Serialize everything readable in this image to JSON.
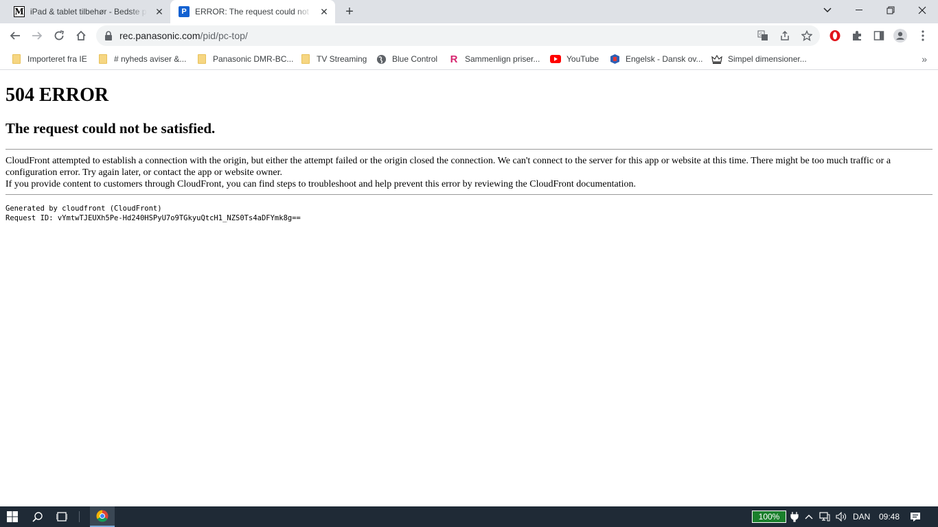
{
  "tabs": [
    {
      "title": "iPad & tablet tilbehør - Bedste priser",
      "favicon": "M",
      "active": false
    },
    {
      "title": "ERROR: The request could not be satisfied",
      "favicon": "P",
      "active": true
    }
  ],
  "toolbar": {
    "url_host": "rec.panasonic.com",
    "url_path": "/pid/pc-top/"
  },
  "bookmarks": [
    {
      "label": "Importeret fra IE",
      "icon": "folder-icon"
    },
    {
      "label": "# nyheds aviser &...",
      "icon": "folder-icon"
    },
    {
      "label": "Panasonic DMR-BC...",
      "icon": "folder-icon"
    },
    {
      "label": "TV Streaming",
      "icon": "folder-icon"
    },
    {
      "label": "Blue Control",
      "icon": "globe-icon"
    },
    {
      "label": "Sammenlign priser...",
      "icon": "pricerunner-icon"
    },
    {
      "label": "YouTube",
      "icon": "youtube-icon"
    },
    {
      "label": "Engelsk - Dansk ov...",
      "icon": "dictionary-icon"
    },
    {
      "label": "Simpel dimensioner...",
      "icon": "crown-icon"
    }
  ],
  "page": {
    "heading": "504 ERROR",
    "subheading": "The request could not be satisfied.",
    "paragraph1": "CloudFront attempted to establish a connection with the origin, but either the attempt failed or the origin closed the connection. We can't connect to the server for this app or website at this time. There might be too much traffic or a configuration error. Try again later, or contact the app or website owner.",
    "paragraph2": "If you provide content to customers through CloudFront, you can find steps to troubleshoot and help prevent this error by reviewing the CloudFront documentation.",
    "generated_by": "Generated by cloudfront (CloudFront)",
    "request_id": "Request ID: vYmtwTJEUXh5Pe-Hd240HSPyU7o9TGkyuQtcH1_NZS0Ts4aDFYmk8g=="
  },
  "taskbar": {
    "battery": "100%",
    "language": "DAN",
    "time": "09:48"
  }
}
